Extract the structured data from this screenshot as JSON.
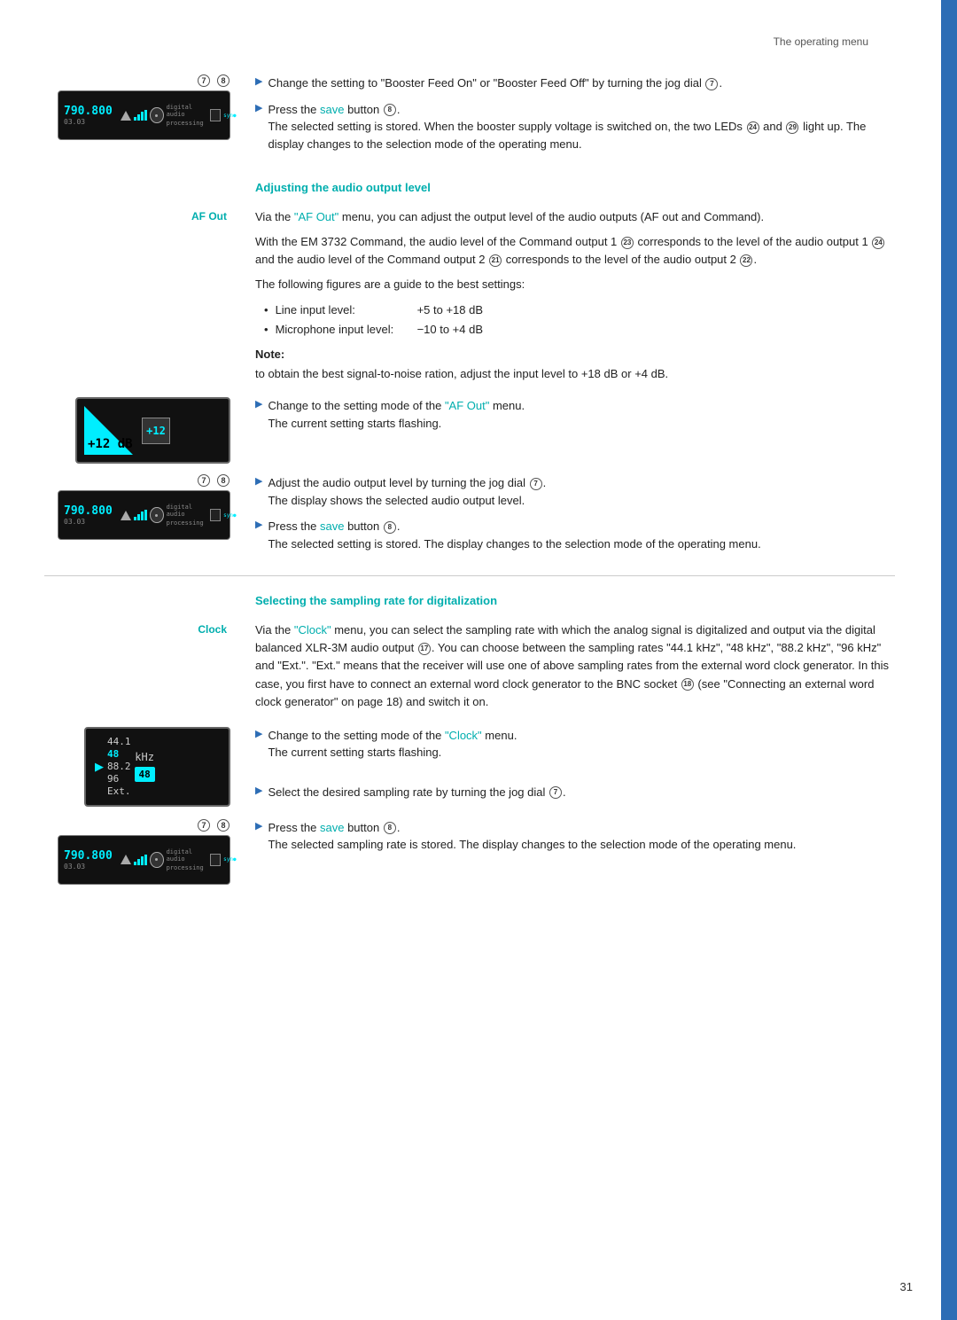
{
  "page": {
    "header": "The operating menu",
    "page_number": "31"
  },
  "sections": {
    "booster_feed": {
      "bullet1_text": "Change the setting to \"Booster Feed On\" or \"Booster Feed Off\" by turning the jog dial",
      "jog_dial_num": "7",
      "bullet2_prefix": "Press the",
      "save_label": "save",
      "bullet2_mid": "button",
      "save_num": "8",
      "bullet2_body": "The selected setting is stored. When the booster supply voltage is switched on, the two LEDs",
      "led_24": "24",
      "and_text": "and",
      "led_29": "29",
      "bullet2_tail": "light up. The display changes to the selection mode of the operating menu."
    },
    "audio_output": {
      "title": "Adjusting the audio output level",
      "label": "AF Out",
      "para1_prefix": "Via the",
      "af_out_link": "\"AF Out\"",
      "para1_body": "menu, you can adjust the output level of the audio outputs (AF out and Command).",
      "para2": "With the EM 3732 Command, the audio level of the Command output 1",
      "cmd1_num": "23",
      "para2b": "corresponds to the level of the audio output 1",
      "ao1_num": "24",
      "para2c": "and the audio level of the Command output 2",
      "cmd2_num": "21",
      "para2d": "corresponds to the level of the audio output 2",
      "ao2_num": "22",
      "para3": "The following figures are a guide to the best settings:",
      "line_label": "Line input level:",
      "line_value": "+5  to  +18 dB",
      "mic_label": "Microphone input level:",
      "mic_value": "−10  to   +4 dB",
      "note_label": "Note:",
      "note_body": "to obtain the best signal-to-noise ration, adjust the input level to +18 dB or +4 dB.",
      "bullet3_prefix": "Change to the setting mode of the",
      "af_out_link2": "\"AF Out\"",
      "bullet3_body": "menu.\nThe current setting starts flashing.",
      "bullet4_text": "Adjust the audio output level by turning the jog dial",
      "jog_num2": "7",
      "bullet4_body": "The display shows the selected audio output level.",
      "bullet5_prefix": "Press the",
      "save2_label": "save",
      "bullet5_mid": "button",
      "save2_num": "8",
      "bullet5_body": "The selected setting is stored. The display changes to the selection mode of the operating menu.",
      "display_db": "+12 dB",
      "display_val": "+12"
    },
    "sampling_rate": {
      "title": "Selecting the sampling rate for digitalization",
      "label": "Clock",
      "para1_prefix": "Via the",
      "clock_link": "\"Clock\"",
      "para1_body": "menu, you can select the sampling rate with which the analog signal is digitalized and output via the digital balanced XLR-3M audio output",
      "audio_num": "17",
      "para1b": ". You can choose between the sampling rates \"44.1 kHz\", \"48 kHz\", \"88.2 kHz\", \"96 kHz\" and \"Ext.\". \"Ext.\" means that the receiver will use one of above sampling rates from the external word clock generator. In this case, you first have to connect an external word clock generator to the BNC socket",
      "bnc_num": "18",
      "para1c": "(see \"Connecting an external word clock generator\" on page 18) and switch it on.",
      "bullet6_prefix": "Change to the setting mode of the",
      "clock_link2": "\"Clock\"",
      "bullet6_body": "menu.\nThe current setting starts flashing.",
      "bullet7_text": "Select the desired sampling rate by turning the jog dial",
      "jog_num3": "7",
      "bullet8_prefix": "Press the",
      "save3_label": "save",
      "bullet8_mid": "button",
      "save3_num": "8",
      "bullet8_body": "The selected sampling rate is stored. The display changes to the selection mode of the operating menu.",
      "clock_rates": [
        "44.1",
        "48",
        "88.2",
        "96",
        "Ext."
      ],
      "clock_active": "48",
      "clock_unit": "kHz"
    }
  }
}
